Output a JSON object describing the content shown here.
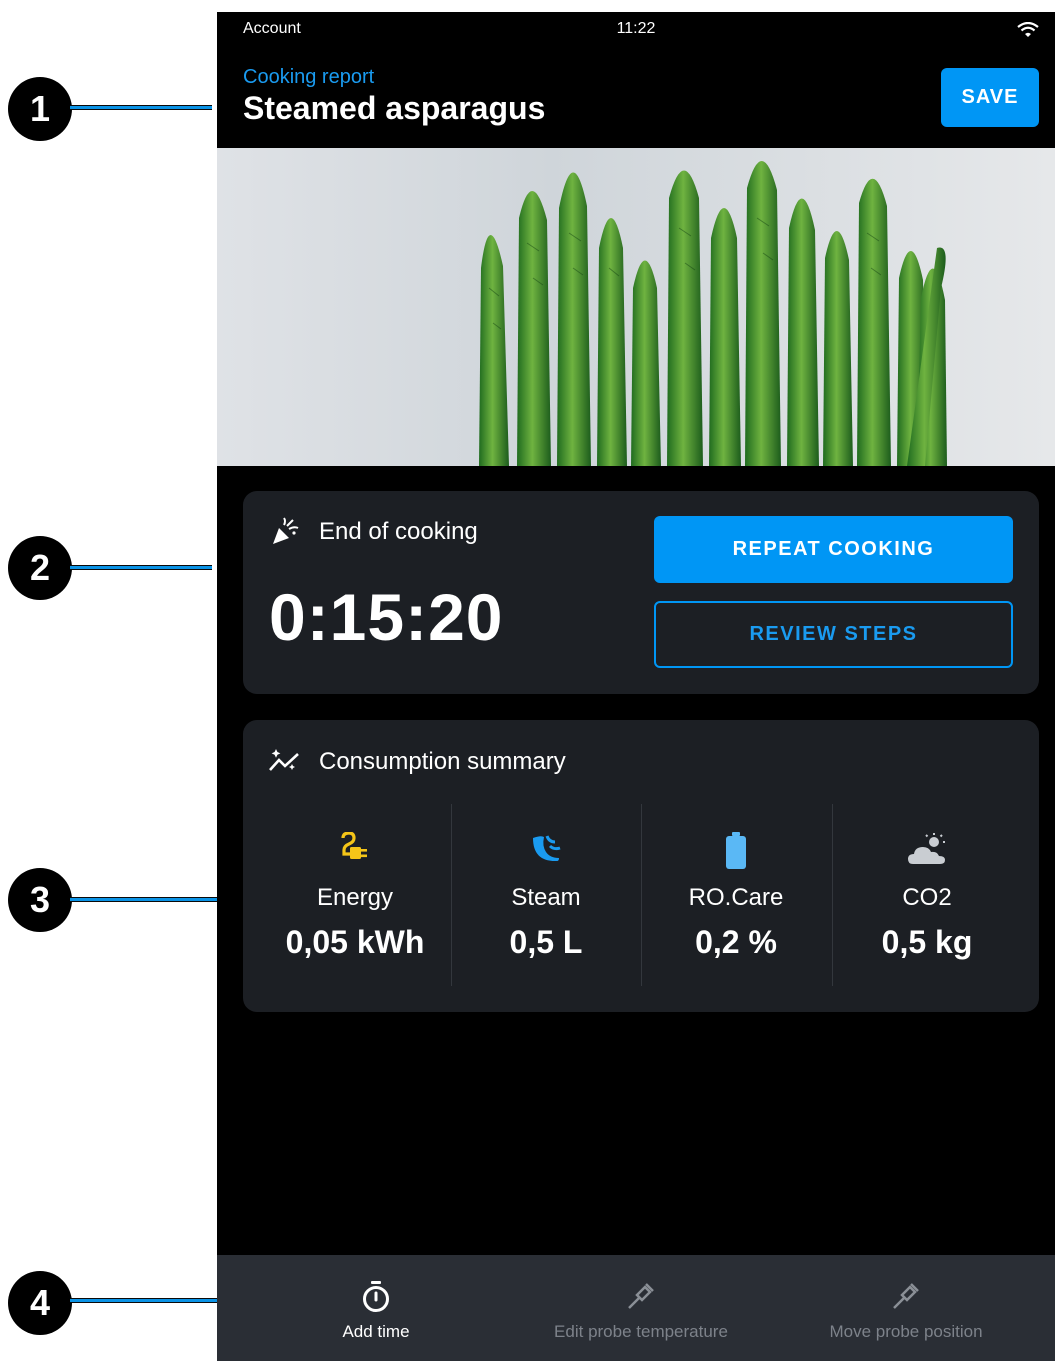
{
  "callouts": [
    "1",
    "2",
    "3",
    "4"
  ],
  "status_bar": {
    "left": "Account",
    "time": "11:22",
    "wifi_icon": "wifi-icon"
  },
  "header": {
    "subtitle": "Cooking report",
    "title": "Steamed asparagus",
    "save_label": "SAVE"
  },
  "end_card": {
    "title": "End of cooking",
    "icon": "party-popper-icon",
    "time": "0:15:20",
    "repeat_label": "REPEAT COOKING",
    "review_label": "REVIEW STEPS"
  },
  "consumption": {
    "title": "Consumption summary",
    "icon": "sparkle-chart-icon",
    "metrics": [
      {
        "label": "Energy",
        "value": "0,05 kWh",
        "icon": "plug-icon",
        "color": "#f5c518"
      },
      {
        "label": "Steam",
        "value": "0,5 L",
        "icon": "steam-icon",
        "color": "#1a9bf0"
      },
      {
        "label": "RO.Care",
        "value": "0,2 %",
        "icon": "battery-icon",
        "color": "#5ab8f5"
      },
      {
        "label": "CO2",
        "value": "0,5 kg",
        "icon": "cloud-sun-icon",
        "color": "#c9cdd2"
      }
    ]
  },
  "bottom_bar": {
    "items": [
      {
        "label": "Add time",
        "icon": "stopwatch-icon",
        "enabled": true
      },
      {
        "label": "Edit probe temperature",
        "icon": "probe-icon",
        "enabled": false
      },
      {
        "label": "Move probe position",
        "icon": "probe-icon",
        "enabled": false
      }
    ]
  },
  "colors": {
    "accent": "#0096f5",
    "background": "#000000",
    "card": "#1c1f24",
    "bottom_bar": "#2a2e35"
  }
}
